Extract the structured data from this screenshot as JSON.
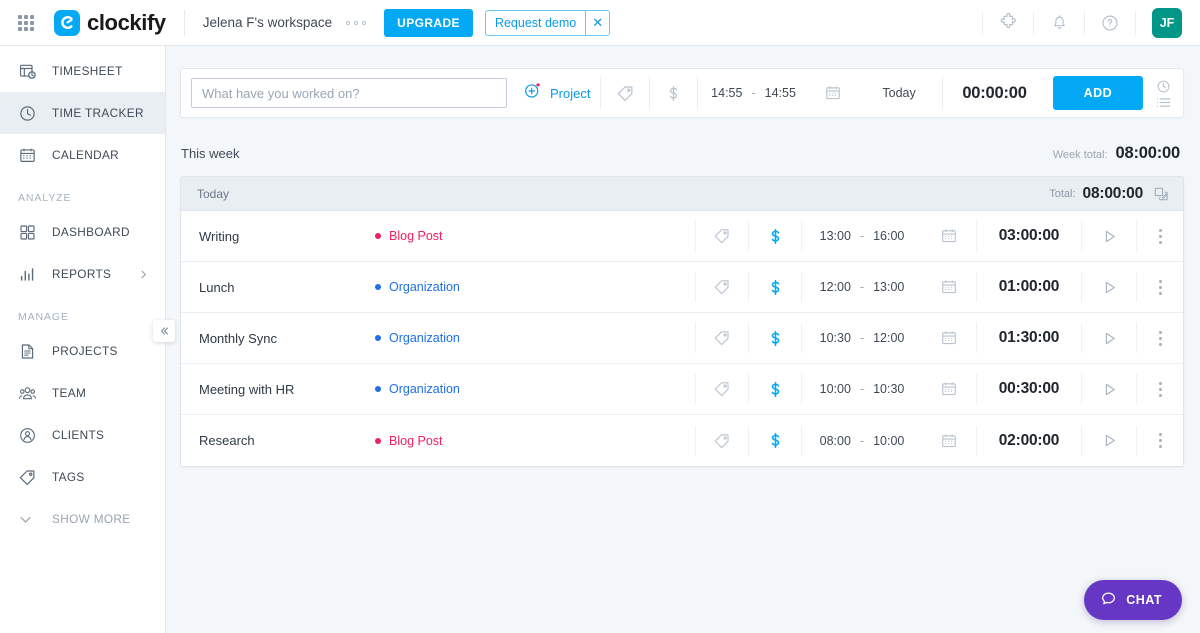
{
  "topbar": {
    "apps_icon": "grid-apps-icon",
    "logo_text": "clockify",
    "workspace": "Jelena F's workspace",
    "workspace_menu_icon": "ellipsis-icon",
    "upgrade_label": "UPGRADE",
    "demo_label": "Request demo",
    "demo_close_icon": "close-icon",
    "integrations_icon": "puzzle-icon",
    "notifications_icon": "bell-icon",
    "help_icon": "question-mark-icon",
    "avatar_initials": "JF",
    "avatar_color": "#009688",
    "accent_color": "#03a9f4"
  },
  "sidebar": {
    "items": [
      {
        "label": "TIMESHEET",
        "icon": "timesheet-icon",
        "active": false
      },
      {
        "label": "TIME TRACKER",
        "icon": "clock-icon",
        "active": true
      },
      {
        "label": "CALENDAR",
        "icon": "calendar-icon",
        "active": false
      }
    ],
    "section_analyze": "ANALYZE",
    "analyze_items": [
      {
        "label": "DASHBOARD",
        "icon": "dashboard-icon",
        "chevron": false
      },
      {
        "label": "REPORTS",
        "icon": "reports-icon",
        "chevron": true
      }
    ],
    "section_manage": "MANAGE",
    "manage_items": [
      {
        "label": "PROJECTS",
        "icon": "projects-icon"
      },
      {
        "label": "TEAM",
        "icon": "team-icon"
      },
      {
        "label": "CLIENTS",
        "icon": "clients-icon"
      },
      {
        "label": "TAGS",
        "icon": "tag-icon"
      }
    ],
    "show_more": "SHOW MORE",
    "show_more_icon": "chevron-down-icon",
    "collapse_icon": "collapse-sidebar-icon"
  },
  "timer": {
    "placeholder": "What have you worked on?",
    "value": "",
    "project_label": "Project",
    "project_add_icon": "add-project-icon",
    "tag_icon": "tag-icon",
    "billable_icon": "dollar-icon",
    "start_time": "14:55",
    "time_dash": "-",
    "end_time": "14:55",
    "calendar_icon": "calendar-icon",
    "day_label": "Today",
    "duration": "00:00:00",
    "add_label": "ADD",
    "mode_icon": "timer-manual-mode-icon"
  },
  "week": {
    "title": "This week",
    "total_label": "Week total:",
    "total_value": "08:00:00"
  },
  "day_group": {
    "day_label": "Today",
    "total_label": "Total:",
    "total_value": "08:00:00",
    "duplicate_icon": "duplicate-icon"
  },
  "project_colors": {
    "Blog Post": "#f2215d",
    "Organization": "#1e6fe8"
  },
  "entries": [
    {
      "description": "Writing",
      "project": "Blog Post",
      "project_color": "#f2215d",
      "tag_icon": "tag-icon",
      "billable_icon": "dollar-icon",
      "start": "13:00",
      "dash": "-",
      "end": "16:00",
      "calendar_icon": "calendar-icon",
      "duration": "03:00:00",
      "play_icon": "play-icon",
      "menu_icon": "kebab-menu-icon"
    },
    {
      "description": "Lunch",
      "project": "Organization",
      "project_color": "#1e6fe8",
      "tag_icon": "tag-icon",
      "billable_icon": "dollar-icon",
      "start": "12:00",
      "dash": "-",
      "end": "13:00",
      "calendar_icon": "calendar-icon",
      "duration": "01:00:00",
      "play_icon": "play-icon",
      "menu_icon": "kebab-menu-icon"
    },
    {
      "description": "Monthly Sync",
      "project": "Organization",
      "project_color": "#1e6fe8",
      "tag_icon": "tag-icon",
      "billable_icon": "dollar-icon",
      "start": "10:30",
      "dash": "-",
      "end": "12:00",
      "calendar_icon": "calendar-icon",
      "duration": "01:30:00",
      "play_icon": "play-icon",
      "menu_icon": "kebab-menu-icon"
    },
    {
      "description": "Meeting with HR",
      "project": "Organization",
      "project_color": "#1e6fe8",
      "tag_icon": "tag-icon",
      "billable_icon": "dollar-icon",
      "start": "10:00",
      "dash": "-",
      "end": "10:30",
      "calendar_icon": "calendar-icon",
      "duration": "00:30:00",
      "play_icon": "play-icon",
      "menu_icon": "kebab-menu-icon"
    },
    {
      "description": "Research",
      "project": "Blog Post",
      "project_color": "#f2215d",
      "tag_icon": "tag-icon",
      "billable_icon": "dollar-icon",
      "start": "08:00",
      "dash": "-",
      "end": "10:00",
      "calendar_icon": "calendar-icon",
      "duration": "02:00:00",
      "play_icon": "play-icon",
      "menu_icon": "kebab-menu-icon"
    }
  ],
  "chat": {
    "label": "CHAT",
    "icon": "chat-bubble-icon",
    "color": "#6637c4"
  }
}
